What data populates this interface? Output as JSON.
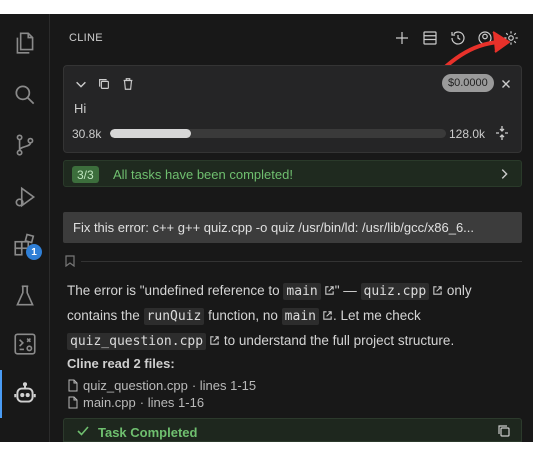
{
  "activity_bar": {
    "items": [
      "explorer-icon",
      "search-icon",
      "source-control-icon",
      "run-debug-icon",
      "extensions-icon",
      "testing-icon",
      "remote-icon",
      "cline-icon"
    ],
    "extensions_badge": "1"
  },
  "panel": {
    "title": "CLINE",
    "header_icons": [
      "plus-icon",
      "history-list-icon",
      "history-icon",
      "account-icon",
      "settings-icon"
    ]
  },
  "task": {
    "text": "Hi",
    "cost": "$0.0000",
    "tokens_used": "30.8k",
    "context_window": "128.0k",
    "progress": 0.24
  },
  "completed_bar": {
    "count": "3/3",
    "text": "All tasks have been completed!"
  },
  "command": {
    "text": "Fix this error: c++ g++ quiz.cpp -o quiz /usr/bin/ld: /usr/lib/gcc/x86_6..."
  },
  "message": {
    "p1": "The error is \"undefined reference to ",
    "c1": "main",
    "p2": "\" — ",
    "c2": "quiz.cpp",
    "p3": " only contains the ",
    "c3": "runQuiz",
    "p4": " function, no ",
    "c4": "main",
    "p5": ". Let me check ",
    "c5": "quiz_question.cpp",
    "p6": " to understand the full project structure."
  },
  "read_files": {
    "title": "Cline read 2 files:",
    "files": [
      {
        "name": "quiz_question.cpp",
        "meta": "· lines 1-15"
      },
      {
        "name": "main.cpp",
        "meta": "· lines 1-16"
      }
    ]
  },
  "completion": {
    "text": "Task Completed"
  },
  "colors": {
    "accent": "#4a9cf5",
    "success": "#6fbf6f",
    "annotation": "#e8312a"
  }
}
